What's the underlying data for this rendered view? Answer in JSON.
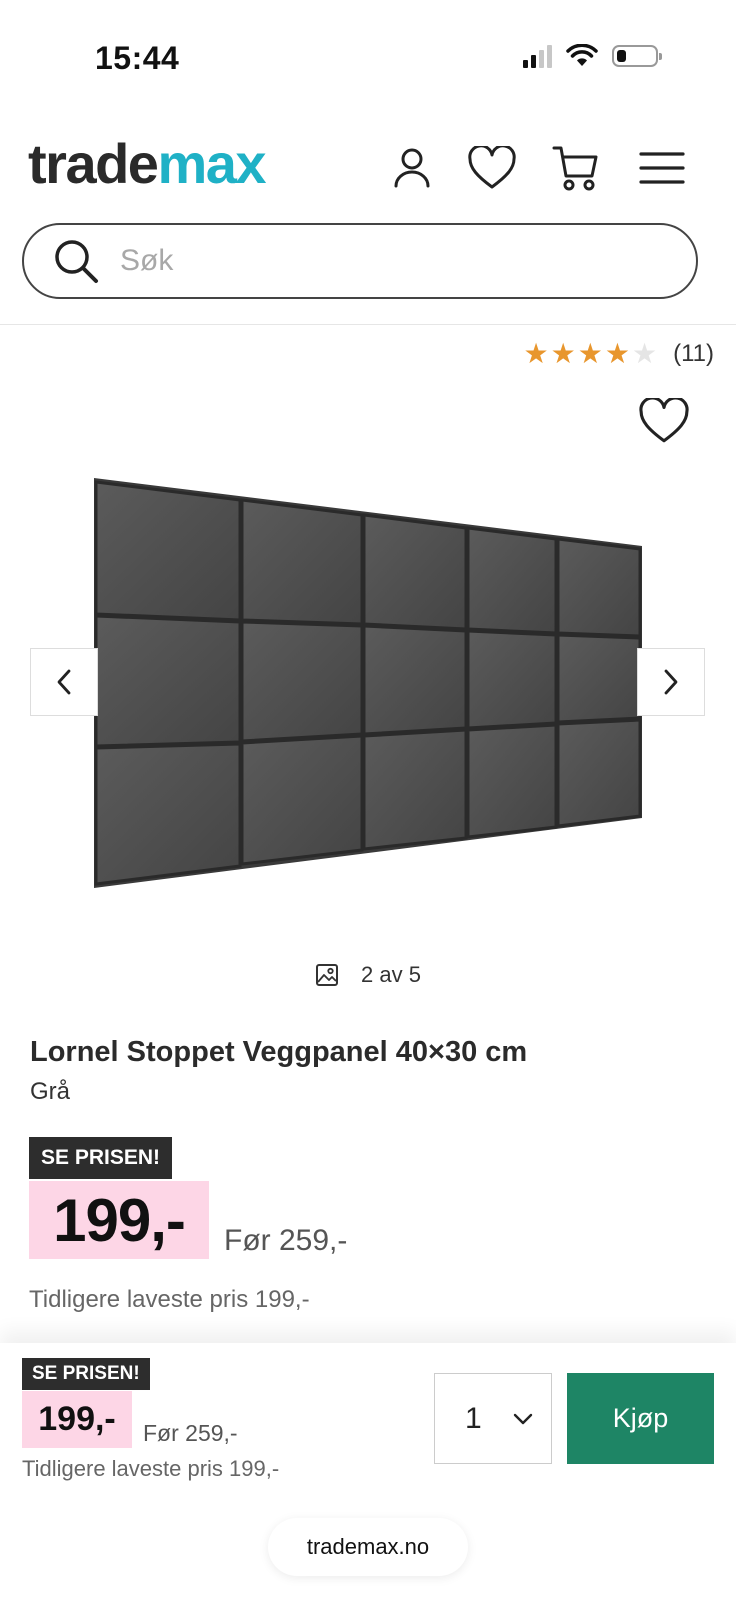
{
  "status_bar": {
    "time": "15:44"
  },
  "header": {
    "logo_part1": "trade",
    "logo_part2": "max",
    "icons": [
      "user-icon",
      "heart-icon",
      "cart-icon",
      "menu-icon"
    ]
  },
  "search": {
    "placeholder": "Søk"
  },
  "product": {
    "rating": {
      "stars": 4,
      "max": 5,
      "count_label": "(11)"
    },
    "gallery_counter": "2 av 5",
    "title": "Lornel Stoppet Veggpanel 40×30 cm",
    "variant": "Grå",
    "badge": "SE PRISEN!",
    "price": "199,-",
    "price_before": "Før 259,-",
    "lowest_price": "Tidligere laveste pris 199,-"
  },
  "sticky_bar": {
    "badge": "SE PRISEN!",
    "price": "199,-",
    "price_before": "Før 259,-",
    "lowest_price": "Tidligere laveste pris 199,-",
    "quantity": "1",
    "buy_label": "Kjøp"
  },
  "browser": {
    "url": "trademax.no"
  },
  "colors": {
    "brand_accent": "#1fb1c6",
    "buy_button": "#1e8565",
    "price_highlight": "#fdd6e6",
    "star": "#e8962d"
  }
}
